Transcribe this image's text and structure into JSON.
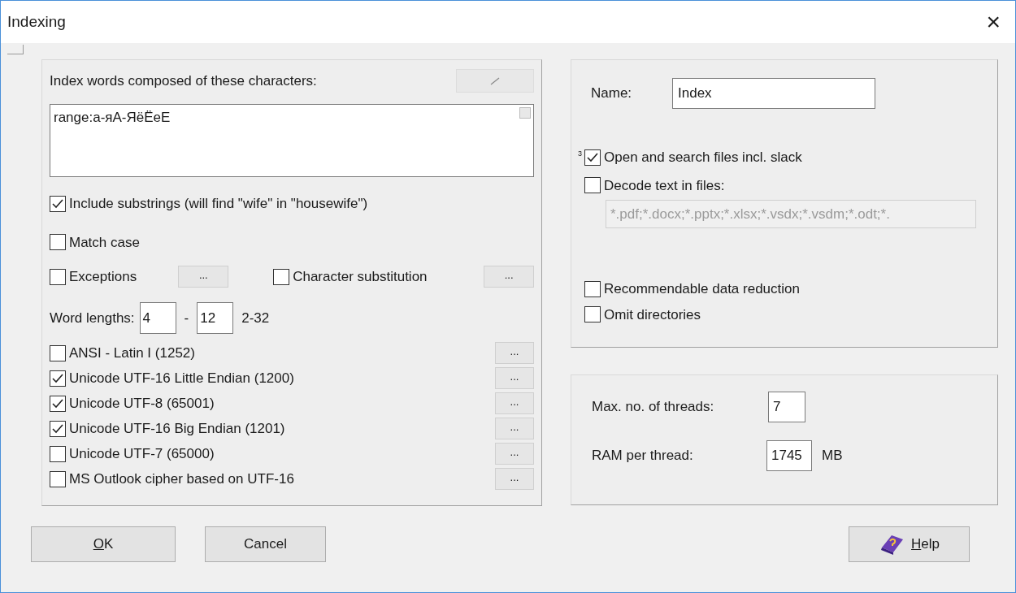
{
  "window": {
    "title": "Indexing",
    "close": "×"
  },
  "characters": {
    "label": "Index words composed of these characters:",
    "value": "range:а-яА-ЯёЁеЕ"
  },
  "options": [
    {
      "label": "Include substrings (will find \"wife\" in \"housewife\")",
      "checked": true
    },
    {
      "label": "Match case",
      "checked": false
    }
  ],
  "exceptions": {
    "label": "Exceptions",
    "checked": false,
    "button": "..."
  },
  "substitution": {
    "label": "Character substitution",
    "checked": false,
    "button": "..."
  },
  "word_lengths": {
    "label": "Word lengths:",
    "min": "4",
    "separator": "-",
    "max": "12",
    "range": "2-32"
  },
  "encodings": [
    {
      "label": "ANSI - Latin I (1252)",
      "checked": false,
      "button": "..."
    },
    {
      "label": "Unicode UTF-16 Little Endian (1200)",
      "checked": true,
      "button": "..."
    },
    {
      "label": "Unicode UTF-8 (65001)",
      "checked": true,
      "button": "..."
    },
    {
      "label": "Unicode UTF-16 Big Endian (1201)",
      "checked": true,
      "button": "..."
    },
    {
      "label": "Unicode UTF-7 (65000)",
      "checked": false,
      "button": "..."
    },
    {
      "label": "MS Outlook cipher based on UTF-16",
      "checked": false,
      "button": "..."
    }
  ],
  "name": {
    "label": "Name:",
    "value": "Index"
  },
  "slack": {
    "marker": "3",
    "label": "Open and search files incl. slack",
    "checked": true
  },
  "decode": {
    "label": "Decode text in files:",
    "checked": false,
    "extensions": "*.pdf;*.docx;*.pptx;*.xlsx;*.vsdx;*.vsdm;*.odt;*.",
    "disabled": true
  },
  "reduction": [
    {
      "label": "Recommendable data reduction",
      "checked": false
    },
    {
      "label": "Omit directories",
      "checked": false
    }
  ],
  "threads": {
    "label": "Max. no. of threads:",
    "value": "7"
  },
  "ram": {
    "label": "RAM per thread:",
    "value": "1745",
    "unit": "MB"
  },
  "buttons": [
    {
      "kind": "ok",
      "accel": "O",
      "rest": "K"
    },
    {
      "kind": "cancel",
      "rest": "Cancel"
    },
    {
      "kind": "help",
      "accel": "H",
      "rest": "elp"
    }
  ]
}
